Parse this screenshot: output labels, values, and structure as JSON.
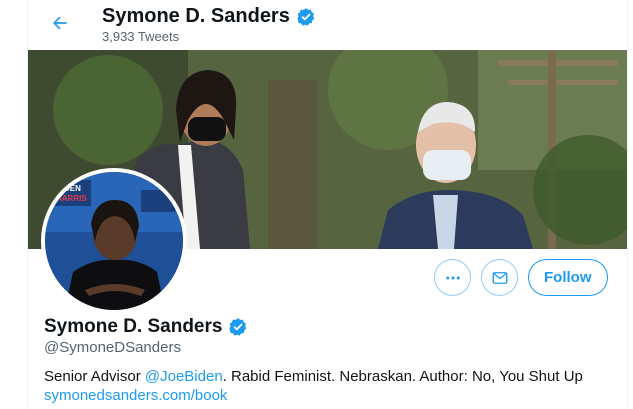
{
  "header": {
    "name": "Symone D. Sanders",
    "tweets": "3,933 Tweets"
  },
  "profile": {
    "name": "Symone D. Sanders",
    "handle": "@SymoneDSanders",
    "bio_prefix": "Senior Advisor ",
    "bio_mention": "@JoeBiden",
    "bio_suffix": ". Rabid Feminist. Nebraskan. Author: No, You Shut Up",
    "website": "symonedsanders.com/book"
  },
  "avatar_sign": {
    "line1": "BIDEN",
    "line2": "HARRIS"
  },
  "actions": {
    "follow_label": "Follow"
  },
  "icons": {
    "back": "arrow-left-icon",
    "verified": "verified-badge-icon",
    "more": "more-icon",
    "message": "envelope-icon"
  },
  "colors": {
    "accent": "#1d9bf0",
    "text": "#0f1419",
    "muted": "#536471"
  }
}
